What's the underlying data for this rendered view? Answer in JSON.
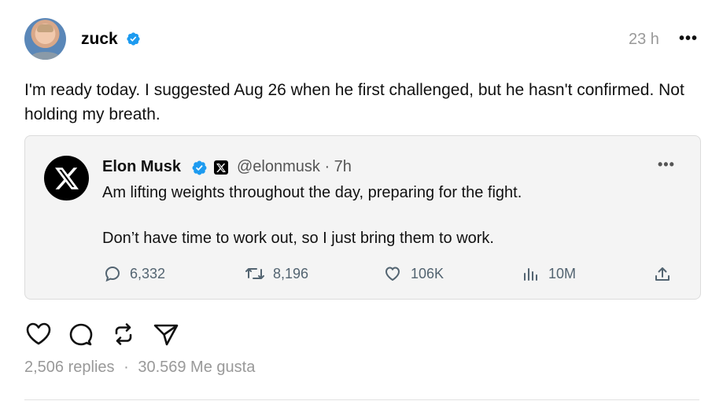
{
  "post": {
    "username": "zuck",
    "time": "23 h",
    "more": "•••",
    "text": "I'm ready today. I suggested Aug 26 when he first challenged, but he hasn't confirmed. Not holding my breath."
  },
  "quote": {
    "name": "Elon Musk",
    "handle": "@elonmusk · 7h",
    "more": "•••",
    "line1": "Am lifting weights throughout the day, preparing for the fight.",
    "line2": "Don’t have time to work out, so I just bring them to work.",
    "replies": "6,332",
    "reposts": "8,196",
    "likes": "106K",
    "views": "10M"
  },
  "footer": {
    "replies": "2,506 replies",
    "sep": "·",
    "likes": "30.569 Me gusta"
  },
  "icons": {
    "verified": "verified-badge-icon",
    "x_logo": "x-logo-icon",
    "like": "heart-icon",
    "comment": "comment-icon",
    "repost": "repost-icon",
    "share": "send-icon",
    "upload": "share-upload-icon"
  },
  "colors": {
    "verified_blue": "#1d9bf0",
    "muted_text": "#999999",
    "x_stat_text": "#536471"
  }
}
